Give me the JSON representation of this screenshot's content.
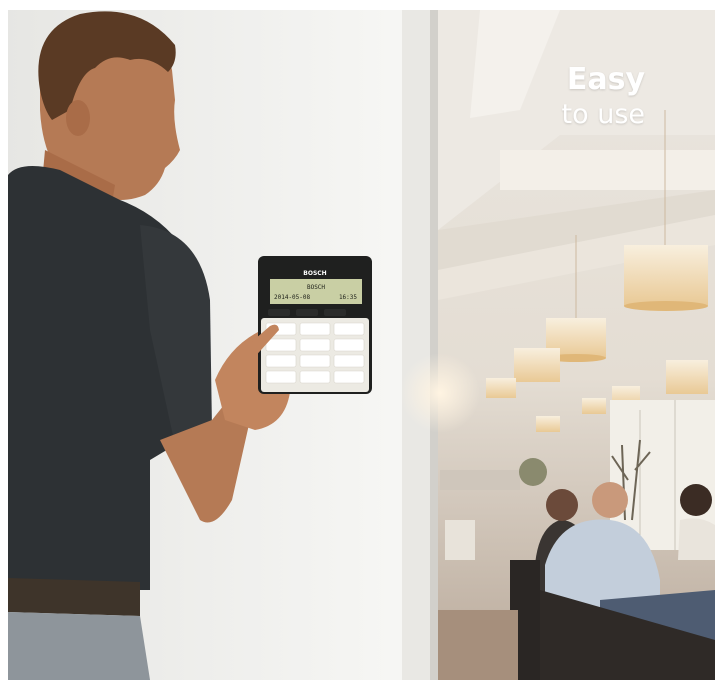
{
  "headline": {
    "line1": "Easy",
    "line2": "to use"
  },
  "keypad": {
    "brand": "BOSCH",
    "display_line1": "BOSCH",
    "display_date": "2014-05-08",
    "display_time": "16:35"
  },
  "colors": {
    "wall": "#f2f2ef",
    "shirt": "#2d3134",
    "skin": "#b57a55",
    "jeans": "#8e959b",
    "lamp": "#f4e4c8",
    "display_green": "#c9cfa4"
  }
}
